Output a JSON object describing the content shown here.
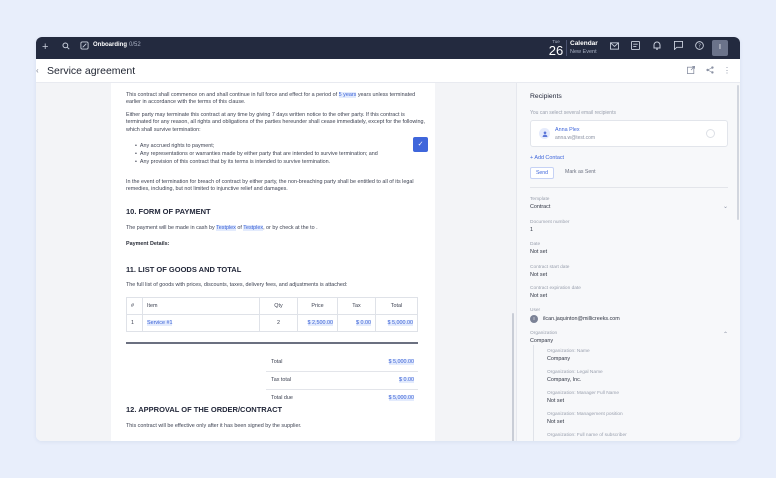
{
  "topbar": {
    "progress_label": "Onboarding",
    "progress_count": "0/52",
    "date_day": "Tue",
    "date_num": "26",
    "calendar_title": "Calendar",
    "calendar_sub": "New Event",
    "avatar_letter": "I"
  },
  "header": {
    "title": "Service agreement"
  },
  "document": {
    "para1_a": "This contract shall commence on and shall continue in full force and effect for a period of ",
    "para1_hl": "5 years",
    "para1_b": " years unless terminated earlier in accordance with the terms of this clause.",
    "para2": "Either party may terminate this contract at any time by giving 7 days written notice to the other party. If this contract is terminated for any reason, all rights and obligations of the parties hereunder shall cease immediately, except for the following, which shall survive termination:",
    "bullets": [
      "Any accrued rights to payment;",
      "Any representations or warranties made by either party that are intended to survive termination; and",
      "Any provision of this contract that by its terms is intended to survive termination."
    ],
    "para3": "In the event of termination for breach of contract by either party, the non-breaching party shall be entitled to all of its legal remedies, including, but not limited to injunctive relief and damages.",
    "heading10": "10. FORM OF PAYMENT",
    "payment_a": "The payment will be made in cash by ",
    "payment_hl1": "Testplex",
    "payment_b": " of ",
    "payment_hl2": "Testplex",
    "payment_c": ", or by check at the to .",
    "payment_details": "Payment Details:",
    "heading11": "11. LIST OF GOODS AND TOTAL",
    "goods_intro": "The full list of goods with prices, discounts, taxes, delivery fees, and adjustments is attached:",
    "table": {
      "headers": [
        "#",
        "Item",
        "Qty",
        "Price",
        "Tax",
        "Total"
      ],
      "rows": [
        [
          "1",
          "Service #1",
          "2",
          "$ 2,500.00",
          "$ 0.00",
          "$ 5,000.00"
        ]
      ]
    },
    "totals": [
      {
        "label": "Total",
        "value": "$ 5,000.00"
      },
      {
        "label": "Tax total",
        "value": "$ 0.00"
      },
      {
        "label": "Total due",
        "value": "$ 5,000.00"
      }
    ],
    "heading12": "12. APPROVAL OF THE ORDER/CONTRACT",
    "approval": "This contract will be effective only after it has been signed by the supplier."
  },
  "panel": {
    "title": "Recipients",
    "hint": "You can select several email recipients",
    "recipient_name": "Anna Plex",
    "recipient_email": "anna.w@test.com",
    "add_contact": "+ Add Contact",
    "send": "Send",
    "mark_sent": "Mark as Sent",
    "fields": [
      {
        "label": "Template",
        "value": "Contract"
      },
      {
        "label": "Document number",
        "value": "1"
      },
      {
        "label": "Date",
        "value": "Not set"
      },
      {
        "label": "Contract start date",
        "value": "Not set"
      },
      {
        "label": "Contract expiration date",
        "value": "Not set"
      },
      {
        "label": "User",
        "value": "ilcan.jaquinton@millicreeks.com"
      },
      {
        "label": "Organization",
        "value": "Company"
      }
    ],
    "org_fields": [
      {
        "label": "Organization: Name",
        "value": "Company"
      },
      {
        "label": "Organization: Legal Name",
        "value": "Company, Inc."
      },
      {
        "label": "Organization: Manager Full Name",
        "value": "Not set"
      },
      {
        "label": "Organization: Management position",
        "value": "Not set"
      },
      {
        "label": "Organization: Full name of subscriber",
        "value": ""
      }
    ],
    "user_initial": "I"
  }
}
